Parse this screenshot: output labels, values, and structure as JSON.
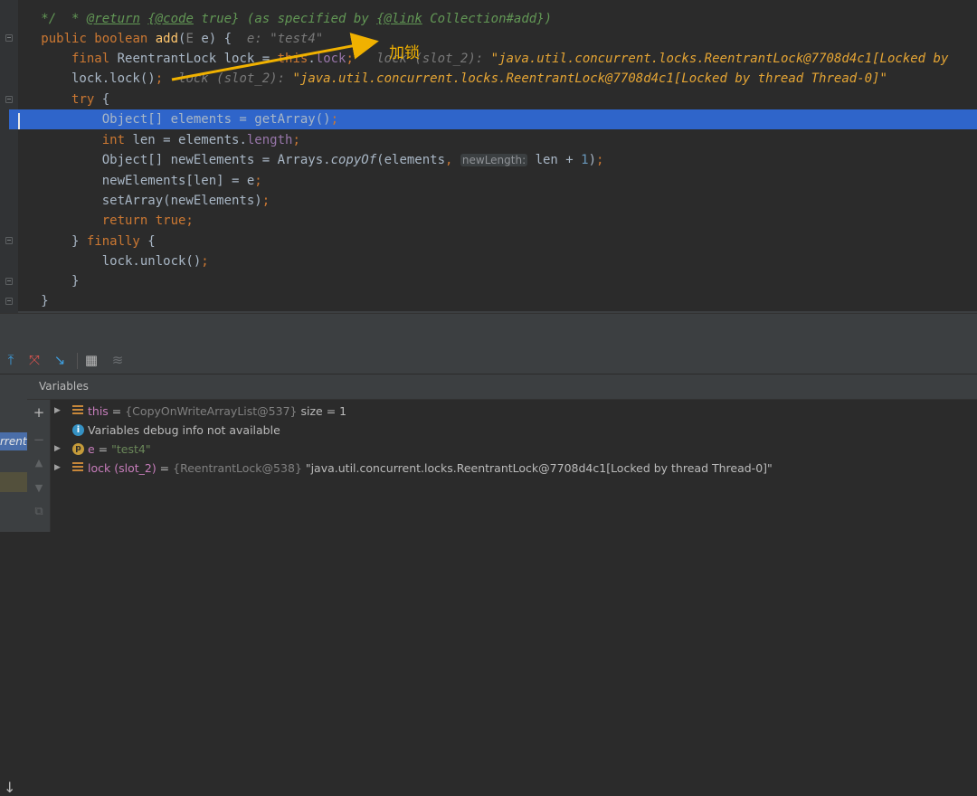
{
  "editor": {
    "lines": [
      {
        "text": "    * @return {@code true} (as specified by {@link Collection#add})"
      },
      {
        "text": "    */"
      },
      {
        "text": "   public boolean add(E e) {",
        "hint": "e: \"test4\""
      },
      {
        "text": "       final ReentrantLock lock = this.lock;",
        "hint_label": "lock (slot_2):",
        "hint_value": "\"java.util.concurrent.locks.ReentrantLock@7708d4c1[Locked by"
      },
      {
        "text": "       lock.lock();",
        "hint_label": "lock (slot_2):",
        "hint_value": "\"java.util.concurrent.locks.ReentrantLock@7708d4c1[Locked by thread Thread-0]\""
      },
      {
        "text": "       try {"
      },
      {
        "text": "           Object[] elements = getArray();"
      },
      {
        "text": "           int len = elements.length;"
      },
      {
        "text": "           Object[] newElements = Arrays.copyOf(elements,",
        "inlay": "newLength:",
        "rest": "len + 1);"
      },
      {
        "text": "           newElements[len] = e;"
      },
      {
        "text": "           setArray(newElements);"
      },
      {
        "text": "           return true;"
      },
      {
        "text": "       } finally {"
      },
      {
        "text": "           lock.unlock();"
      },
      {
        "text": "       }"
      },
      {
        "text": "   }"
      }
    ],
    "annotation": "加锁"
  },
  "debug": {
    "toolbar_icons": [
      "show-execution-point-icon",
      "drop-frame-icon",
      "run-to-cursor-icon",
      "evaluate-expression-icon",
      "trace-icon"
    ],
    "variables_title": "Variables",
    "frame_label": "rrent",
    "variables": [
      {
        "name": "this",
        "eq": " = ",
        "type": "{CopyOnWriteArrayList@537}",
        "value": "size = 1"
      },
      {
        "info": "Variables debug info not available"
      },
      {
        "name": "e",
        "eq": " = ",
        "value": "\"test4\""
      },
      {
        "name": "lock (slot_2)",
        "eq": " = ",
        "type": "{ReentrantLock@538}",
        "value": "\"java.util.concurrent.locks.ReentrantLock@7708d4c1[Locked by thread Thread-0]\""
      }
    ]
  },
  "colors": {
    "editor_bg": "#2b2b2b",
    "selection": "#2f65ca",
    "annotation": "#f0b100",
    "keyword": "#cc7832",
    "hint_value": "#e5a534"
  }
}
